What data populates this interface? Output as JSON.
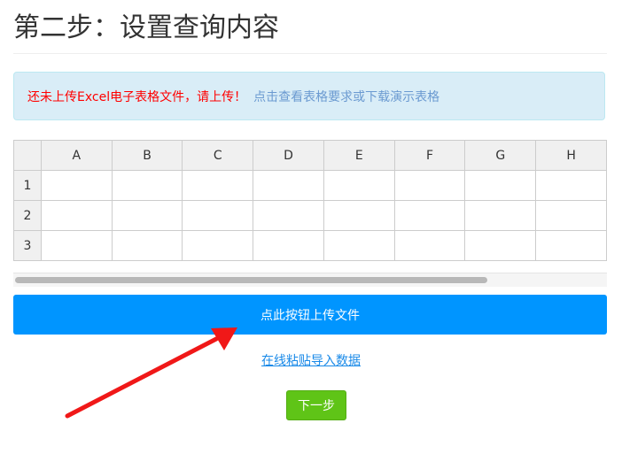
{
  "page": {
    "title": "第二步：设置查询内容"
  },
  "alert": {
    "warning": "还未上传Excel电子表格文件，请上传！",
    "link": "点击查看表格要求或下载演示表格"
  },
  "sheet": {
    "columns": [
      "A",
      "B",
      "C",
      "D",
      "E",
      "F",
      "G",
      "H"
    ],
    "rows": [
      "1",
      "2",
      "3"
    ]
  },
  "actions": {
    "upload_label": "点此按钮上传文件",
    "paste_link": "在线粘贴导入数据",
    "next_label": "下一步"
  },
  "colors": {
    "upload_button": "#0095ff",
    "next_button": "#5fc417",
    "alert_bg": "#d9edf7",
    "warning_text": "#ff0000",
    "arrow": "#f01818"
  },
  "annotation": {
    "icon": "red-arrow-icon"
  }
}
